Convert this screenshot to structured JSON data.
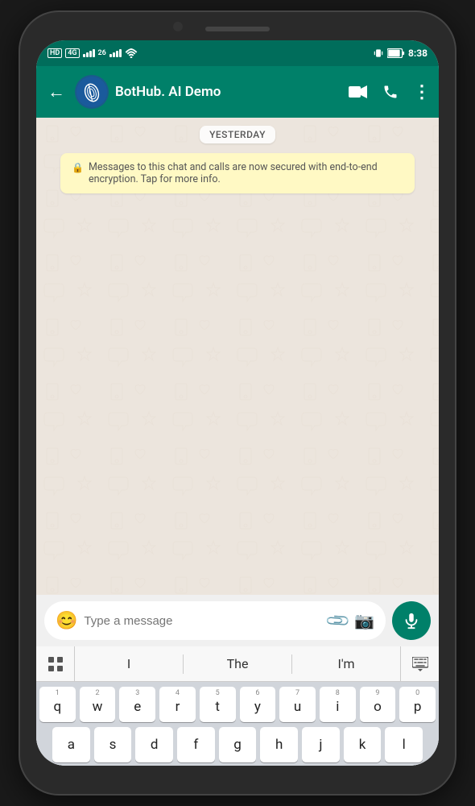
{
  "phone": {
    "status_bar": {
      "left": "HD  4G  26  signal  wifi",
      "time": "8:38",
      "battery": "battery"
    },
    "header": {
      "back_label": "←",
      "contact_name": "BotHub. AI Demo",
      "video_icon": "video",
      "call_icon": "phone",
      "more_icon": "⋮"
    },
    "chat": {
      "date_separator": "YESTERDAY",
      "encryption_notice": "Messages to this chat and calls are now secured with end-to-end encryption. Tap for more info."
    },
    "input": {
      "placeholder": "Type a message",
      "emoji_icon": "😊",
      "attach_icon": "📎",
      "camera_icon": "📷",
      "mic_icon": "🎤"
    },
    "keyboard": {
      "suggestions": [
        "I",
        "The",
        "I'm"
      ],
      "rows": [
        [
          {
            "num": "1",
            "letter": "q"
          },
          {
            "num": "2",
            "letter": "w"
          },
          {
            "num": "3",
            "letter": "e"
          },
          {
            "num": "4",
            "letter": "r"
          },
          {
            "num": "5",
            "letter": "t"
          },
          {
            "num": "6",
            "letter": "y"
          },
          {
            "num": "7",
            "letter": "u"
          },
          {
            "num": "8",
            "letter": "i"
          },
          {
            "num": "9",
            "letter": "o"
          },
          {
            "num": "0",
            "letter": "p"
          }
        ]
      ]
    }
  }
}
